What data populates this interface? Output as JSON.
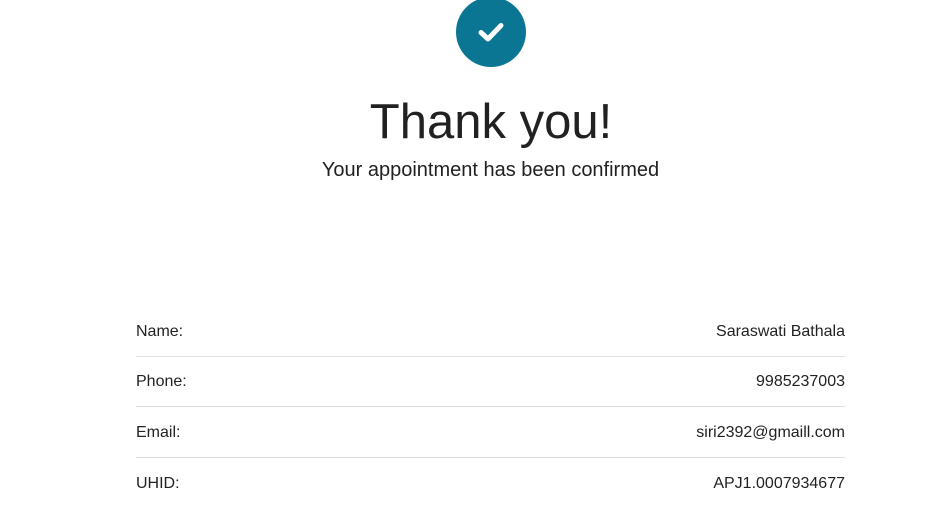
{
  "confirmation": {
    "title": "Thank you!",
    "subtitle": "Your appointment has been confirmed",
    "icon": "check-icon",
    "accent_color": "#0b7693"
  },
  "details": [
    {
      "label": "Name:",
      "value": "Saraswati Bathala"
    },
    {
      "label": "Phone:",
      "value": "9985237003"
    },
    {
      "label": "Email:",
      "value": "siri2392@gmaill.com"
    },
    {
      "label": "UHID:",
      "value": "APJ1.0007934677"
    }
  ]
}
